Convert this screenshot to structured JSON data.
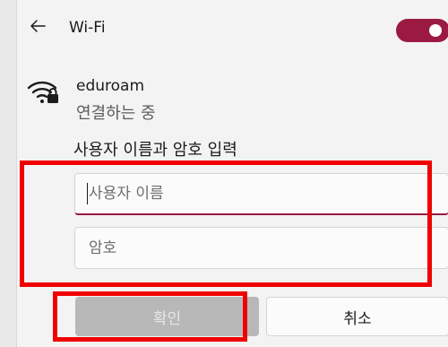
{
  "header": {
    "title": "Wi-Fi",
    "wifi_enabled": true
  },
  "network": {
    "name": "eduroam",
    "status": "연결하는 중",
    "icon": "wifi-secured-icon"
  },
  "auth": {
    "prompt": "사용자 이름과 암호 입력",
    "username": {
      "placeholder": "사용자 이름",
      "value": ""
    },
    "password": {
      "placeholder": "암호",
      "value": ""
    }
  },
  "buttons": {
    "confirm_label": "확인",
    "cancel_label": "취소"
  },
  "colors": {
    "accent": "#9a1a42",
    "highlight": "#f10000"
  }
}
